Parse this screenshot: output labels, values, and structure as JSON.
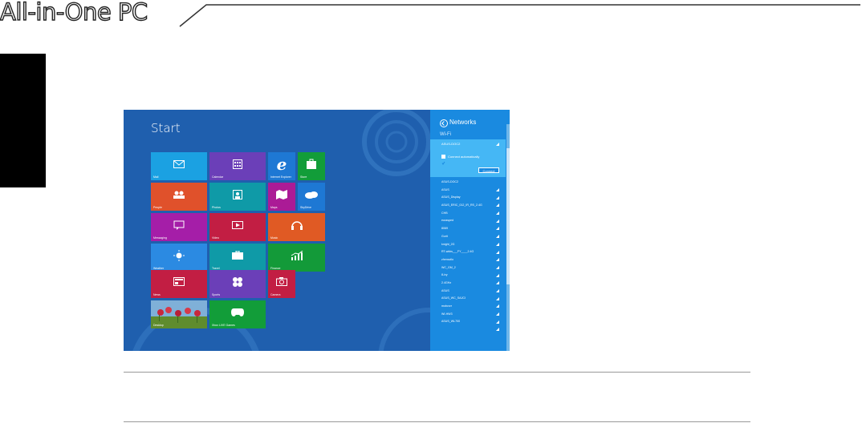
{
  "page": {
    "header_title": "All-in-One PC"
  },
  "screenshot": {
    "start_label": "Start",
    "tiles": [
      {
        "id": "mail",
        "label": "Mail",
        "color": "#1ba1e2",
        "icon": "mail-icon"
      },
      {
        "id": "calendar",
        "label": "Calendar",
        "color": "#6b3fb8",
        "icon": "calendar-icon"
      },
      {
        "id": "ie",
        "label": "Internet Explorer",
        "color": "#1e78d4",
        "icon": "internet-explorer-icon"
      },
      {
        "id": "store",
        "label": "Store",
        "color": "#129d39",
        "icon": "store-icon"
      },
      {
        "id": "people",
        "label": "People",
        "color": "#e0512b",
        "icon": "people-icon"
      },
      {
        "id": "photos",
        "label": "Photos",
        "color": "#0f9aa7",
        "icon": "photos-icon"
      },
      {
        "id": "maps",
        "label": "Maps",
        "color": "#ab1b96",
        "icon": "maps-icon"
      },
      {
        "id": "skydrive",
        "label": "SkyDrive",
        "color": "#1e78d4",
        "icon": "skydrive-icon"
      },
      {
        "id": "messaging",
        "label": "Messaging",
        "color": "#a51ea8",
        "icon": "messaging-icon"
      },
      {
        "id": "video",
        "label": "Video",
        "color": "#c21e43",
        "icon": "video-icon"
      },
      {
        "id": "music",
        "label": "Music",
        "color": "#e05a24",
        "icon": "music-icon"
      },
      {
        "id": "weather",
        "label": "Weather",
        "color": "#2b8ae2",
        "icon": "weather-icon"
      },
      {
        "id": "travel",
        "label": "Travel",
        "color": "#0f9aa7",
        "icon": "travel-icon"
      },
      {
        "id": "finance",
        "label": "Finance",
        "color": "#139a39",
        "icon": "finance-icon"
      },
      {
        "id": "news",
        "label": "News",
        "color": "#c21e43",
        "icon": "news-icon"
      },
      {
        "id": "sports",
        "label": "Sports",
        "color": "#6b3fb8",
        "icon": "sports-icon"
      },
      {
        "id": "camera",
        "label": "Camera",
        "color": "#c21e43",
        "icon": "camera-icon"
      },
      {
        "id": "desktop",
        "label": "Desktop",
        "color": "#6b9a3a",
        "icon": "desktop-image"
      },
      {
        "id": "xbox",
        "label": "Xbox LIVE Games",
        "color": "#129d39",
        "icon": "xbox-icon"
      }
    ],
    "networks_panel": {
      "title": "Networks",
      "wifi_label": "Wi-Fi",
      "selected_network": "ASUS-DOC2",
      "connect_auto_label": "Connect automatically",
      "connect_button": "Connect",
      "networks": [
        "ASUS-DOC2",
        "ASUS",
        "ASUS_Display",
        "ASUS_ERIC_012_IR_RS_2.4G",
        "CHB",
        "eurasped",
        "8069",
        "Gurit",
        "knight_2G",
        "RT-wkbs___FY____2.4G",
        "zhenszilo",
        "WC_GM_2",
        "8-ivy",
        "2.4GHz",
        "ASUS",
        "ASUS_WC_SAJCI",
        "mobcrzr",
        "WI-HW3",
        "ASUS_WL700"
      ]
    }
  }
}
